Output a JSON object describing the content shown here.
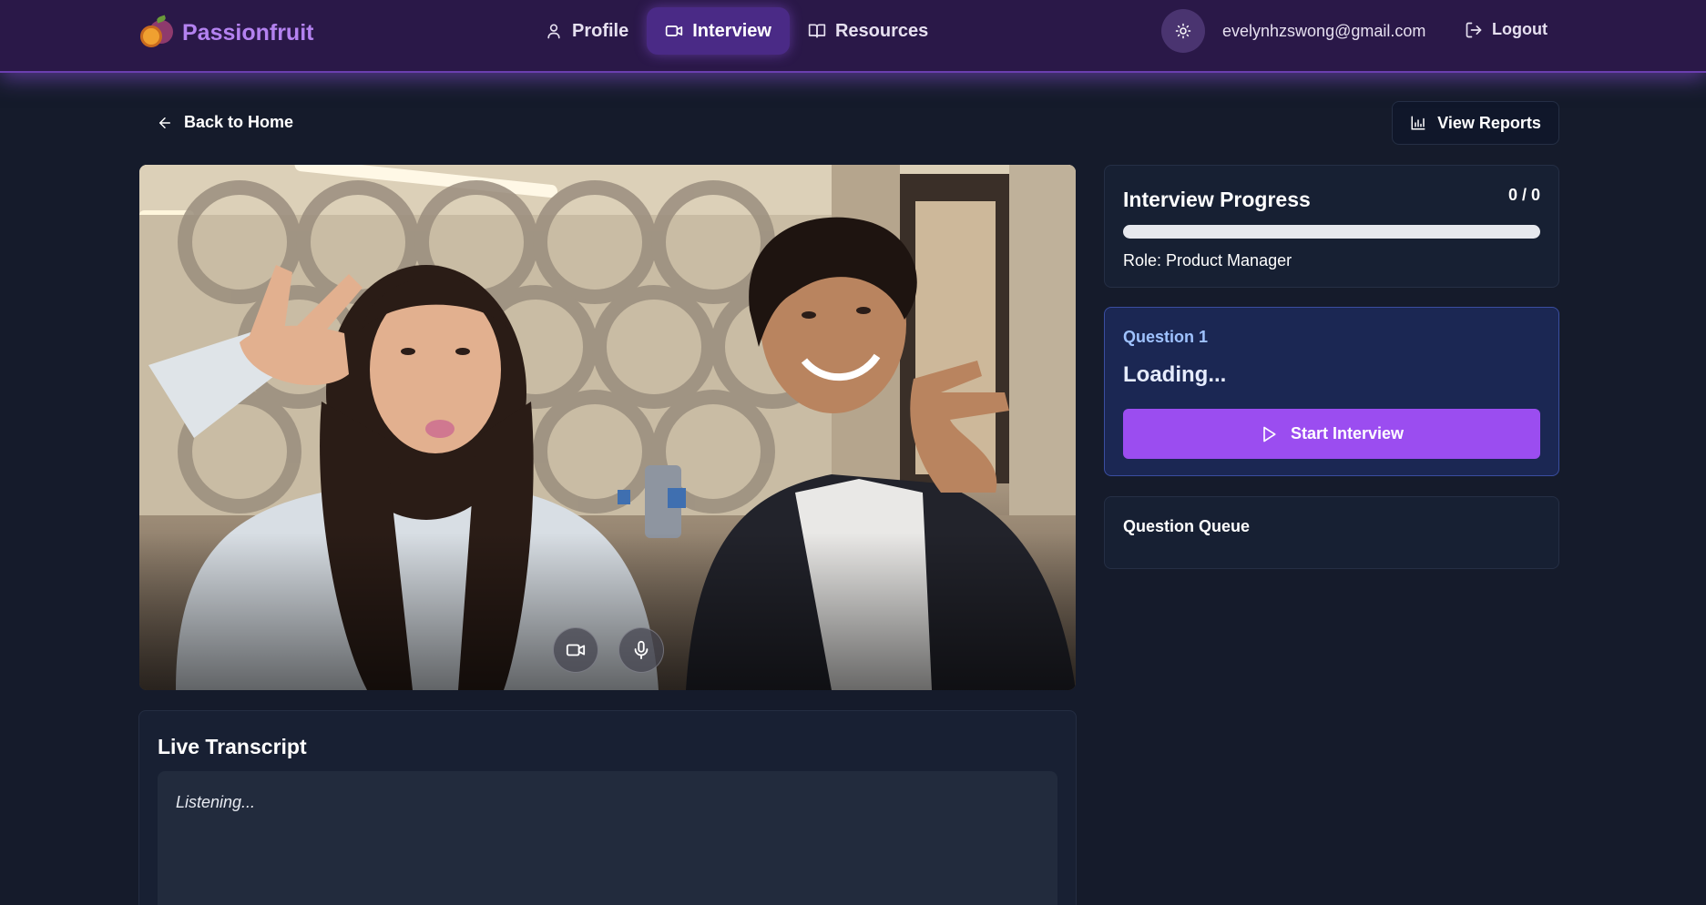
{
  "navbar": {
    "brand": "Passionfruit",
    "items": [
      {
        "label": "Profile",
        "icon": "user-icon",
        "active": false
      },
      {
        "label": "Interview",
        "icon": "video-camera-icon",
        "active": true
      },
      {
        "label": "Resources",
        "icon": "book-icon",
        "active": false
      }
    ],
    "theme_toggle_icon": "sun-icon",
    "user_email": "evelynhzswong@gmail.com",
    "logout_label": "Logout"
  },
  "actions": {
    "back_label": "Back to Home",
    "reports_label": "View Reports"
  },
  "video": {
    "controls": [
      {
        "icon": "video-camera-icon"
      },
      {
        "icon": "microphone-icon"
      }
    ]
  },
  "transcript": {
    "title": "Live Transcript",
    "text": "Listening..."
  },
  "progress": {
    "title": "Interview Progress",
    "count": "0 / 0",
    "fraction": 0,
    "role": "Role: Product Manager"
  },
  "question": {
    "number_label": "Question 1",
    "text": "Loading...",
    "start_label": "Start Interview"
  },
  "queue": {
    "title": "Question Queue"
  },
  "colors": {
    "accent": "#9b4df0",
    "navbar": "#2a1848",
    "background": "#151b2b",
    "brand": "#b482f0"
  }
}
